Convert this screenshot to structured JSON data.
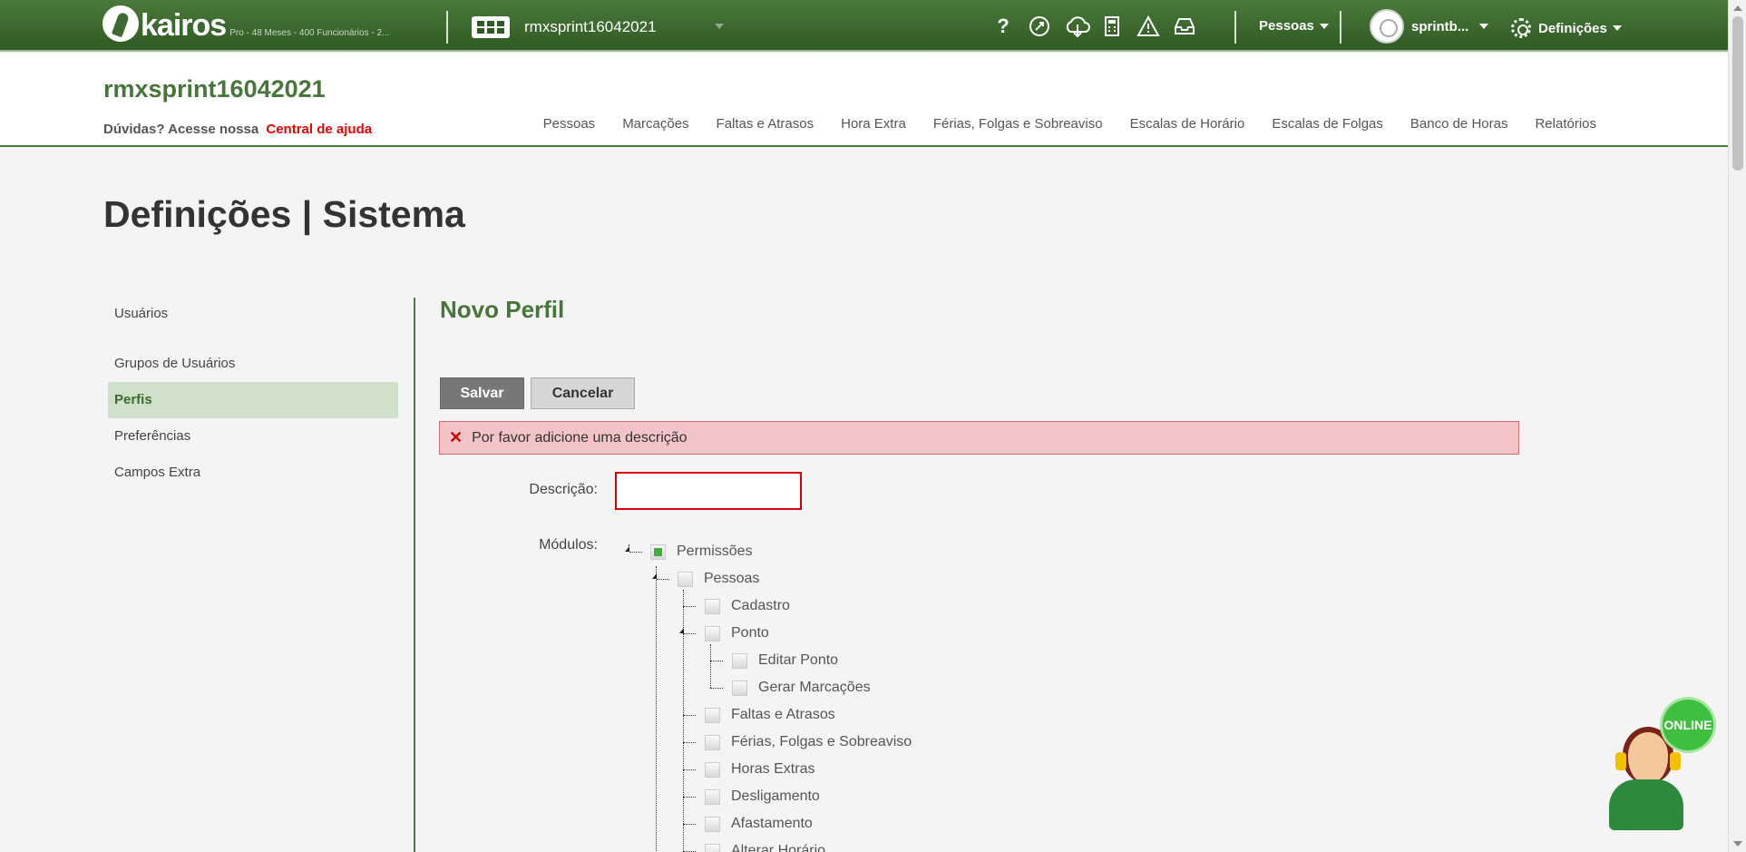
{
  "topbar": {
    "logo_text": "kairos",
    "plan": "Pro - 48 Meses - 400 Funcionários - 2...",
    "company": "rmxsprint16042021",
    "icons": [
      "help-icon",
      "rocket-icon",
      "cloud-download-icon",
      "calculator-icon",
      "warning-icon",
      "inbox-icon"
    ],
    "help_glyph": "?",
    "people_menu": "Pessoas",
    "user_menu": "sprintb...",
    "settings_menu": "Definições"
  },
  "header": {
    "company_title": "rmxsprint16042021",
    "help_prefix": "Dúvidas? Acesse nossa",
    "help_link": "Central de ajuda",
    "nav": [
      "Pessoas",
      "Marcações",
      "Faltas e Atrasos",
      "Hora Extra",
      "Férias, Folgas e Sobreaviso",
      "Escalas de Horário",
      "Escalas de Folgas",
      "Banco de Horas",
      "Relatórios"
    ]
  },
  "page_title": "Definições | Sistema",
  "sidebar": {
    "items": [
      {
        "label": "Usuários",
        "active": false
      },
      {
        "label": "Grupos de Usuários",
        "active": false
      },
      {
        "label": "Perfis",
        "active": true
      },
      {
        "label": "Preferências",
        "active": false
      },
      {
        "label": "Campos Extra",
        "active": false
      }
    ]
  },
  "form": {
    "title": "Novo Perfil",
    "save_label": "Salvar",
    "cancel_label": "Cancelar",
    "alert": "Por favor adicione uma descrição",
    "description_label": "Descrição:",
    "description_value": "",
    "modules_label": "Módulos:"
  },
  "tree": [
    {
      "label": "Permissões",
      "level": 0,
      "state": "partial"
    },
    {
      "label": "Pessoas",
      "level": 1,
      "state": "unchecked"
    },
    {
      "label": "Cadastro",
      "level": 2,
      "state": "unchecked"
    },
    {
      "label": "Ponto",
      "level": 2,
      "state": "unchecked"
    },
    {
      "label": "Editar Ponto",
      "level": 3,
      "state": "unchecked"
    },
    {
      "label": "Gerar Marcações",
      "level": 3,
      "state": "unchecked"
    },
    {
      "label": "Faltas e Atrasos",
      "level": 2,
      "state": "unchecked"
    },
    {
      "label": "Férias, Folgas e Sobreaviso",
      "level": 2,
      "state": "unchecked"
    },
    {
      "label": "Horas Extras",
      "level": 2,
      "state": "unchecked"
    },
    {
      "label": "Desligamento",
      "level": 2,
      "state": "unchecked"
    },
    {
      "label": "Afastamento",
      "level": 2,
      "state": "unchecked"
    },
    {
      "label": "Alterar Horário",
      "level": 2,
      "state": "unchecked"
    }
  ],
  "chat_widget": {
    "badge": "ONLINE"
  },
  "colors": {
    "brand_green": "#47763a",
    "alert_bg": "#f2c4c8",
    "error_red": "#dd0000"
  }
}
